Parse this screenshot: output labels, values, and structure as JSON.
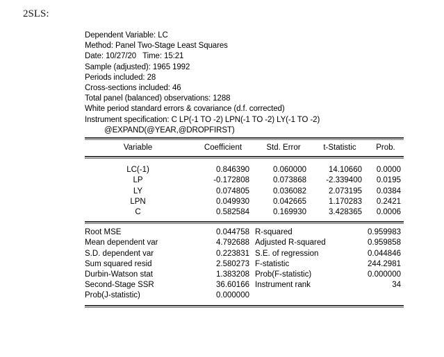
{
  "caption": "2SLS:",
  "report": {
    "header_lines": [
      {
        "text": "Dependent Variable: LC",
        "indent": false
      },
      {
        "text": "Method: Panel Two-Stage Least Squares",
        "indent": false
      },
      {
        "text": "Date: 10/27/20   Time: 15:21",
        "indent": false
      },
      {
        "text": "Sample (adjusted): 1965 1992",
        "indent": false
      },
      {
        "text": "Periods included: 28",
        "indent": false
      },
      {
        "text": "Cross-sections included: 46",
        "indent": false
      },
      {
        "text": "Total panel (balanced) observations: 1288",
        "indent": false
      },
      {
        "text": "White period standard errors & covariance (d.f. corrected)",
        "indent": false
      },
      {
        "text": "Instrument specification: C LP(-1 TO -2) LPN(-1 TO -2) LY(-1 TO -2)",
        "indent": false
      },
      {
        "text": "@EXPAND(@YEAR,@DROPFIRST)",
        "indent": true
      }
    ],
    "columns": {
      "variable": "Variable",
      "coefficient": "Coefficient",
      "std_error": "Std. Error",
      "t_statistic": "t-Statistic",
      "prob": "Prob."
    },
    "coefficients": [
      {
        "variable": "LC(-1)",
        "coefficient": "0.846390",
        "std_error": "0.060000",
        "t_statistic": "14.10660",
        "prob": "0.0000"
      },
      {
        "variable": "LP",
        "coefficient": "-0.172808",
        "std_error": "0.073868",
        "t_statistic": "-2.339400",
        "prob": "0.0195"
      },
      {
        "variable": "LY",
        "coefficient": "0.074805",
        "std_error": "0.036082",
        "t_statistic": "2.073195",
        "prob": "0.0384"
      },
      {
        "variable": "LPN",
        "coefficient": "0.049930",
        "std_error": "0.042665",
        "t_statistic": "1.170283",
        "prob": "0.2421"
      },
      {
        "variable": "C",
        "coefficient": "0.582584",
        "std_error": "0.169930",
        "t_statistic": "3.428365",
        "prob": "0.0006"
      }
    ],
    "summary": [
      {
        "label_left": "Root MSE",
        "value_left": "0.044758",
        "label_right": "R-squared",
        "value_right": "0.959983"
      },
      {
        "label_left": "Mean dependent var",
        "value_left": "4.792688",
        "label_right": "Adjusted R-squared",
        "value_right": "0.959858"
      },
      {
        "label_left": "S.D. dependent var",
        "value_left": "0.223831",
        "label_right": "S.E. of regression",
        "value_right": "0.044846"
      },
      {
        "label_left": "Sum squared resid",
        "value_left": "2.580273",
        "label_right": "F-statistic",
        "value_right": "244.2981"
      },
      {
        "label_left": "Durbin-Watson stat",
        "value_left": "1.383208",
        "label_right": "Prob(F-statistic)",
        "value_right": "0.000000"
      },
      {
        "label_left": "Second-Stage SSR",
        "value_left": "36.60166",
        "label_right": "Instrument rank",
        "value_right": "34"
      },
      {
        "label_left": "Prob(J-statistic)",
        "value_left": "0.000000",
        "label_right": "",
        "value_right": ""
      }
    ]
  },
  "colors": {
    "text": "#000000",
    "rule": "#3d3d3d",
    "background": "#ffffff"
  }
}
